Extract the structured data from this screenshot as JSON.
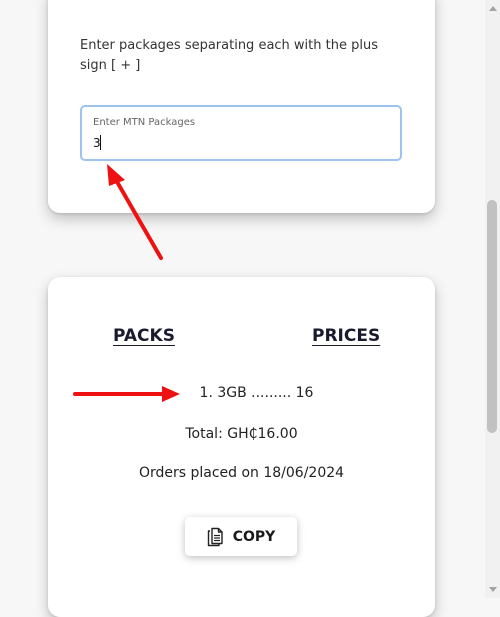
{
  "package_form": {
    "instructions": "Enter packages separating each with the plus sign [ + ]",
    "input_label": "Enter MTN Packages",
    "input_value": "3"
  },
  "summary": {
    "packs_heading": "PACKS",
    "prices_heading": "PRICES",
    "line_item": "1. 3GB ......... 16",
    "total": "Total: GH₵16.00",
    "orders_placed": "Orders placed on 18/06/2024",
    "copy_label": "COPY"
  },
  "icons": {
    "copy": "document-copy-icon",
    "annotation": "red-arrow-annotation"
  },
  "colors": {
    "annotation_red": "#ee1111",
    "input_focus_border": "#9ec3ee"
  }
}
